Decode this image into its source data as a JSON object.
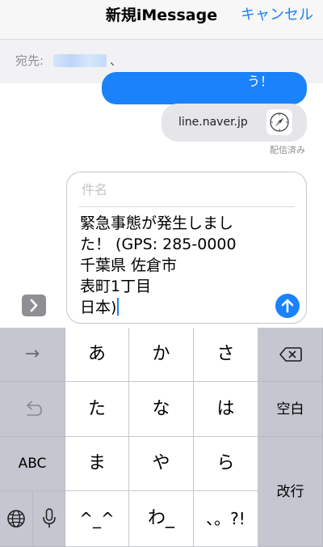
{
  "nav": {
    "title": "新規iMessage",
    "cancel_label": "キャンセル"
  },
  "recipient": {
    "to_label": "宛先:",
    "separator": "、"
  },
  "conversation": {
    "sent_bubble_text": "う！",
    "link_preview": {
      "domain": "line.naver.jp",
      "icon": "safari-compass-icon"
    },
    "delivery_status": "配信済み"
  },
  "compose": {
    "subject_placeholder": "件名",
    "message_lines": [
      "緊急事態が発生しまし",
      "た！ (GPS: 285-0000",
      "千葉県 佐倉市",
      "表町1丁目",
      "日本)"
    ],
    "send_icon": "arrow-up-icon",
    "expand_icon": "chevron-right-icon"
  },
  "keyboard": {
    "keys": {
      "arrow": "→",
      "a": "あ",
      "ka": "か",
      "sa": "さ",
      "delete": "delete-icon",
      "undo": "undo-icon",
      "ta": "た",
      "na": "な",
      "ha": "は",
      "space": "空白",
      "abc": "ABC",
      "ma": "ま",
      "ya": "や",
      "ra": "ら",
      "return": "改行",
      "globe": "globe-icon",
      "mic": "microphone-icon",
      "kaomoji": "^_^",
      "wa": "わ_",
      "punct": "、。?!"
    }
  },
  "colors": {
    "accent": "#1a82fb",
    "bubble_gray": "#e5e5ea",
    "keyboard_bg": "#d1d3d9",
    "key_light": "#ffffff",
    "key_dark": "#c4c7cf"
  }
}
